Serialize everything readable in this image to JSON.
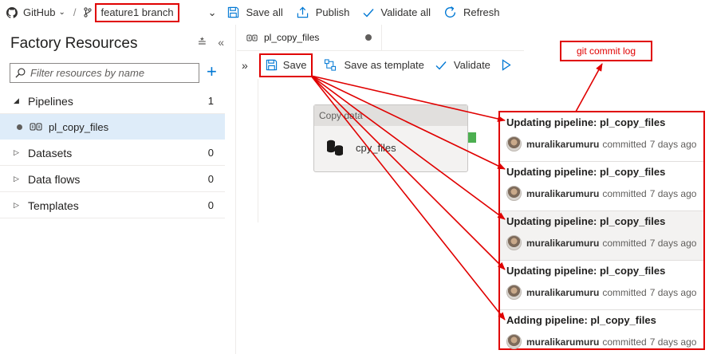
{
  "toolbar": {
    "repo_label": "GitHub",
    "separator": "/",
    "branch_label": "feature1 branch",
    "save_all_label": "Save all",
    "publish_label": "Publish",
    "validate_all_label": "Validate all",
    "refresh_label": "Refresh"
  },
  "sidebar": {
    "title": "Factory Resources",
    "filter_placeholder": "Filter resources by name",
    "items": [
      {
        "label": "Pipelines",
        "count": "1"
      },
      {
        "label": "pl_copy_files",
        "count": ""
      },
      {
        "label": "Datasets",
        "count": "0"
      },
      {
        "label": "Data flows",
        "count": "0"
      },
      {
        "label": "Templates",
        "count": "0"
      }
    ]
  },
  "editor": {
    "tab_label": "pl_copy_files",
    "save_label": "Save",
    "save_template_label": "Save as template",
    "validate_label": "Validate",
    "activity_type": "Copy data",
    "activity_name": "cpy_files"
  },
  "annotation": {
    "git_label": "git commit log"
  },
  "commits": [
    {
      "message": "Updating pipeline: pl_copy_files",
      "author": "muralikarumuru",
      "action": "committed",
      "time": "7 days ago"
    },
    {
      "message": "Updating pipeline: pl_copy_files",
      "author": "muralikarumuru",
      "action": "committed",
      "time": "7 days ago"
    },
    {
      "message": "Updating pipeline: pl_copy_files",
      "author": "muralikarumuru",
      "action": "committed",
      "time": "7 days ago"
    },
    {
      "message": "Updating pipeline: pl_copy_files",
      "author": "muralikarumuru",
      "action": "committed",
      "time": "7 days ago"
    },
    {
      "message": "Adding pipeline: pl_copy_files",
      "author": "muralikarumuru",
      "action": "committed",
      "time": "7 days ago"
    }
  ],
  "colors": {
    "accent": "#0078d4",
    "highlight": "#e00000",
    "selection": "#deecf9",
    "activity_status": "#4caf50"
  },
  "icons": [
    "github-icon",
    "chevron-down-icon",
    "branch-icon",
    "save-icon",
    "publish-icon",
    "check-icon",
    "refresh-icon",
    "collapse-icon",
    "double-chevron-left-icon",
    "search-icon",
    "plus-icon",
    "pipeline-icon",
    "template-icon",
    "play-icon",
    "copy-data-icon",
    "avatar"
  ]
}
